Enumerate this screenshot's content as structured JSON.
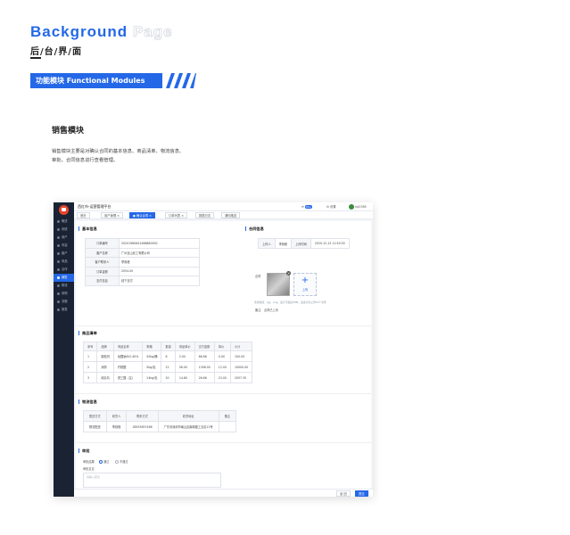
{
  "header": {
    "title_a": "Background",
    "title_b": "Page",
    "subtitle": "后/台/界/面",
    "banner": "功能模块  Functional Modules",
    "accent_color": "#2468e8"
  },
  "section": {
    "title": "销售模块",
    "desc_line1": "销售模块主要是对确认合同的基本信息、商品清单、物流信息、",
    "desc_line2": "审批、合同信息进行查看管理。"
  },
  "app": {
    "app_name": "西红市-运营管理平台",
    "topbar": {
      "notice_label": "消息",
      "notice_count": "99+",
      "settings_label": "设置",
      "username": "hq2389"
    },
    "sidebar": [
      {
        "label": "概述"
      },
      {
        "label": "系统"
      },
      {
        "label": "用户"
      },
      {
        "label": "内容"
      },
      {
        "label": "客户"
      },
      {
        "label": "商品"
      },
      {
        "label": "合作"
      },
      {
        "label": "销售",
        "active": true
      },
      {
        "label": "物流"
      },
      {
        "label": "采购"
      },
      {
        "label": "流程"
      },
      {
        "label": "报表"
      }
    ],
    "tabs": [
      {
        "label": "首页"
      },
      {
        "label": "用户管理 ×"
      },
      {
        "label": "● 确认合同 ×",
        "active": true
      },
      {
        "label": "订单列表 ×"
      },
      {
        "label": "数据日志"
      },
      {
        "label": "通知推送"
      }
    ],
    "basic_info": {
      "title": "基本信息",
      "rows": [
        {
          "k": "订单编号",
          "v": "20201980641466860000"
        },
        {
          "k": "客户名称",
          "v": "广州至山化工有限公司"
        },
        {
          "k": "客户联系人",
          "v": "李则峰"
        },
        {
          "k": "订单金额",
          "v": "2054.00"
        },
        {
          "k": "支付信息",
          "v": "线下支付"
        }
      ]
    },
    "contract_info": {
      "title": "合同信息",
      "table": [
        [
          "上传人",
          "李则峰",
          "上传时间",
          "2020-12-12 11:50:35"
        ]
      ],
      "attach_label": "合同",
      "upload_label": "上传",
      "hint": "支持格式：jpg、png，最大不超过5MB，最多允许上传10个文件",
      "note_label": "备注",
      "note_value": "合同已上传"
    },
    "goods": {
      "title": "商品清单",
      "headers": [
        "序号",
        "品牌",
        "商品名称",
        "规格",
        "数量",
        "商品单价",
        "交付金额",
        "单价",
        "小计"
      ],
      "rows": [
        [
          "1",
          "胶粘剂",
          "硅酸钠SIO-40%",
          "50kg/桶",
          "6",
          "2.00",
          "66.66",
          "0.00",
          "100.00"
        ],
        [
          "2",
          "润滑",
          "柠檬酸",
          "5kg/包",
          "12",
          "56.00",
          "1396.00",
          "12.00",
          "10000.00"
        ],
        [
          "3",
          "纯氢氧",
          "把工酸（注）",
          "24kg/包",
          "20",
          "14.80",
          "26.66",
          "23.00",
          "2057.35"
        ]
      ]
    },
    "logistics": {
      "title": "物流信息",
      "headers": [
        "配送方式",
        "收货人",
        "联系方式",
        "收货地址",
        "备注"
      ],
      "rows": [
        [
          "物流配送",
          "李则峰",
          "18933657466",
          "广东省深圳市南山区南新路工业区12号",
          ""
        ]
      ]
    },
    "approval": {
      "title": "审批",
      "result_label": "审批结果",
      "options": [
        "通过",
        "不通过"
      ],
      "opinion_label": "审批意见",
      "placeholder": "请输入意见"
    },
    "footer": {
      "back_label": "返 回",
      "submit_label": "提交"
    }
  }
}
